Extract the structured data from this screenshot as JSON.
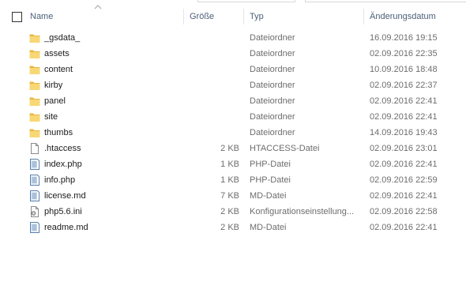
{
  "header": {
    "name": "Name",
    "size": "Größe",
    "type": "Typ",
    "date": "Änderungsdatum"
  },
  "rows": [
    {
      "name": "_gsdata_",
      "size": "",
      "type": "Dateiordner",
      "date": "16.09.2016 19:15",
      "icon": "folder-icon"
    },
    {
      "name": "assets",
      "size": "",
      "type": "Dateiordner",
      "date": "02.09.2016 22:35",
      "icon": "folder-icon"
    },
    {
      "name": "content",
      "size": "",
      "type": "Dateiordner",
      "date": "10.09.2016 18:48",
      "icon": "folder-icon"
    },
    {
      "name": "kirby",
      "size": "",
      "type": "Dateiordner",
      "date": "02.09.2016 22:37",
      "icon": "folder-icon"
    },
    {
      "name": "panel",
      "size": "",
      "type": "Dateiordner",
      "date": "02.09.2016 22:41",
      "icon": "folder-icon"
    },
    {
      "name": "site",
      "size": "",
      "type": "Dateiordner",
      "date": "02.09.2016 22:41",
      "icon": "folder-icon"
    },
    {
      "name": "thumbs",
      "size": "",
      "type": "Dateiordner",
      "date": "14.09.2016 19:43",
      "icon": "folder-icon"
    },
    {
      "name": ".htaccess",
      "size": "2 KB",
      "type": "HTACCESS-Datei",
      "date": "02.09.2016 23:01",
      "icon": "blank-file-icon"
    },
    {
      "name": "index.php",
      "size": "1 KB",
      "type": "PHP-Datei",
      "date": "02.09.2016 22:41",
      "icon": "text-file-icon"
    },
    {
      "name": "info.php",
      "size": "1 KB",
      "type": "PHP-Datei",
      "date": "02.09.2016 22:59",
      "icon": "text-file-icon"
    },
    {
      "name": "license.md",
      "size": "7 KB",
      "type": "MD-Datei",
      "date": "02.09.2016 22:41",
      "icon": "text-file-icon"
    },
    {
      "name": "php5.6.ini",
      "size": "2 KB",
      "type": "Konfigurationseinstellung...",
      "date": "02.09.2016 22:58",
      "icon": "config-file-icon"
    },
    {
      "name": "readme.md",
      "size": "2 KB",
      "type": "MD-Datei",
      "date": "02.09.2016 22:41",
      "icon": "text-file-icon"
    }
  ]
}
